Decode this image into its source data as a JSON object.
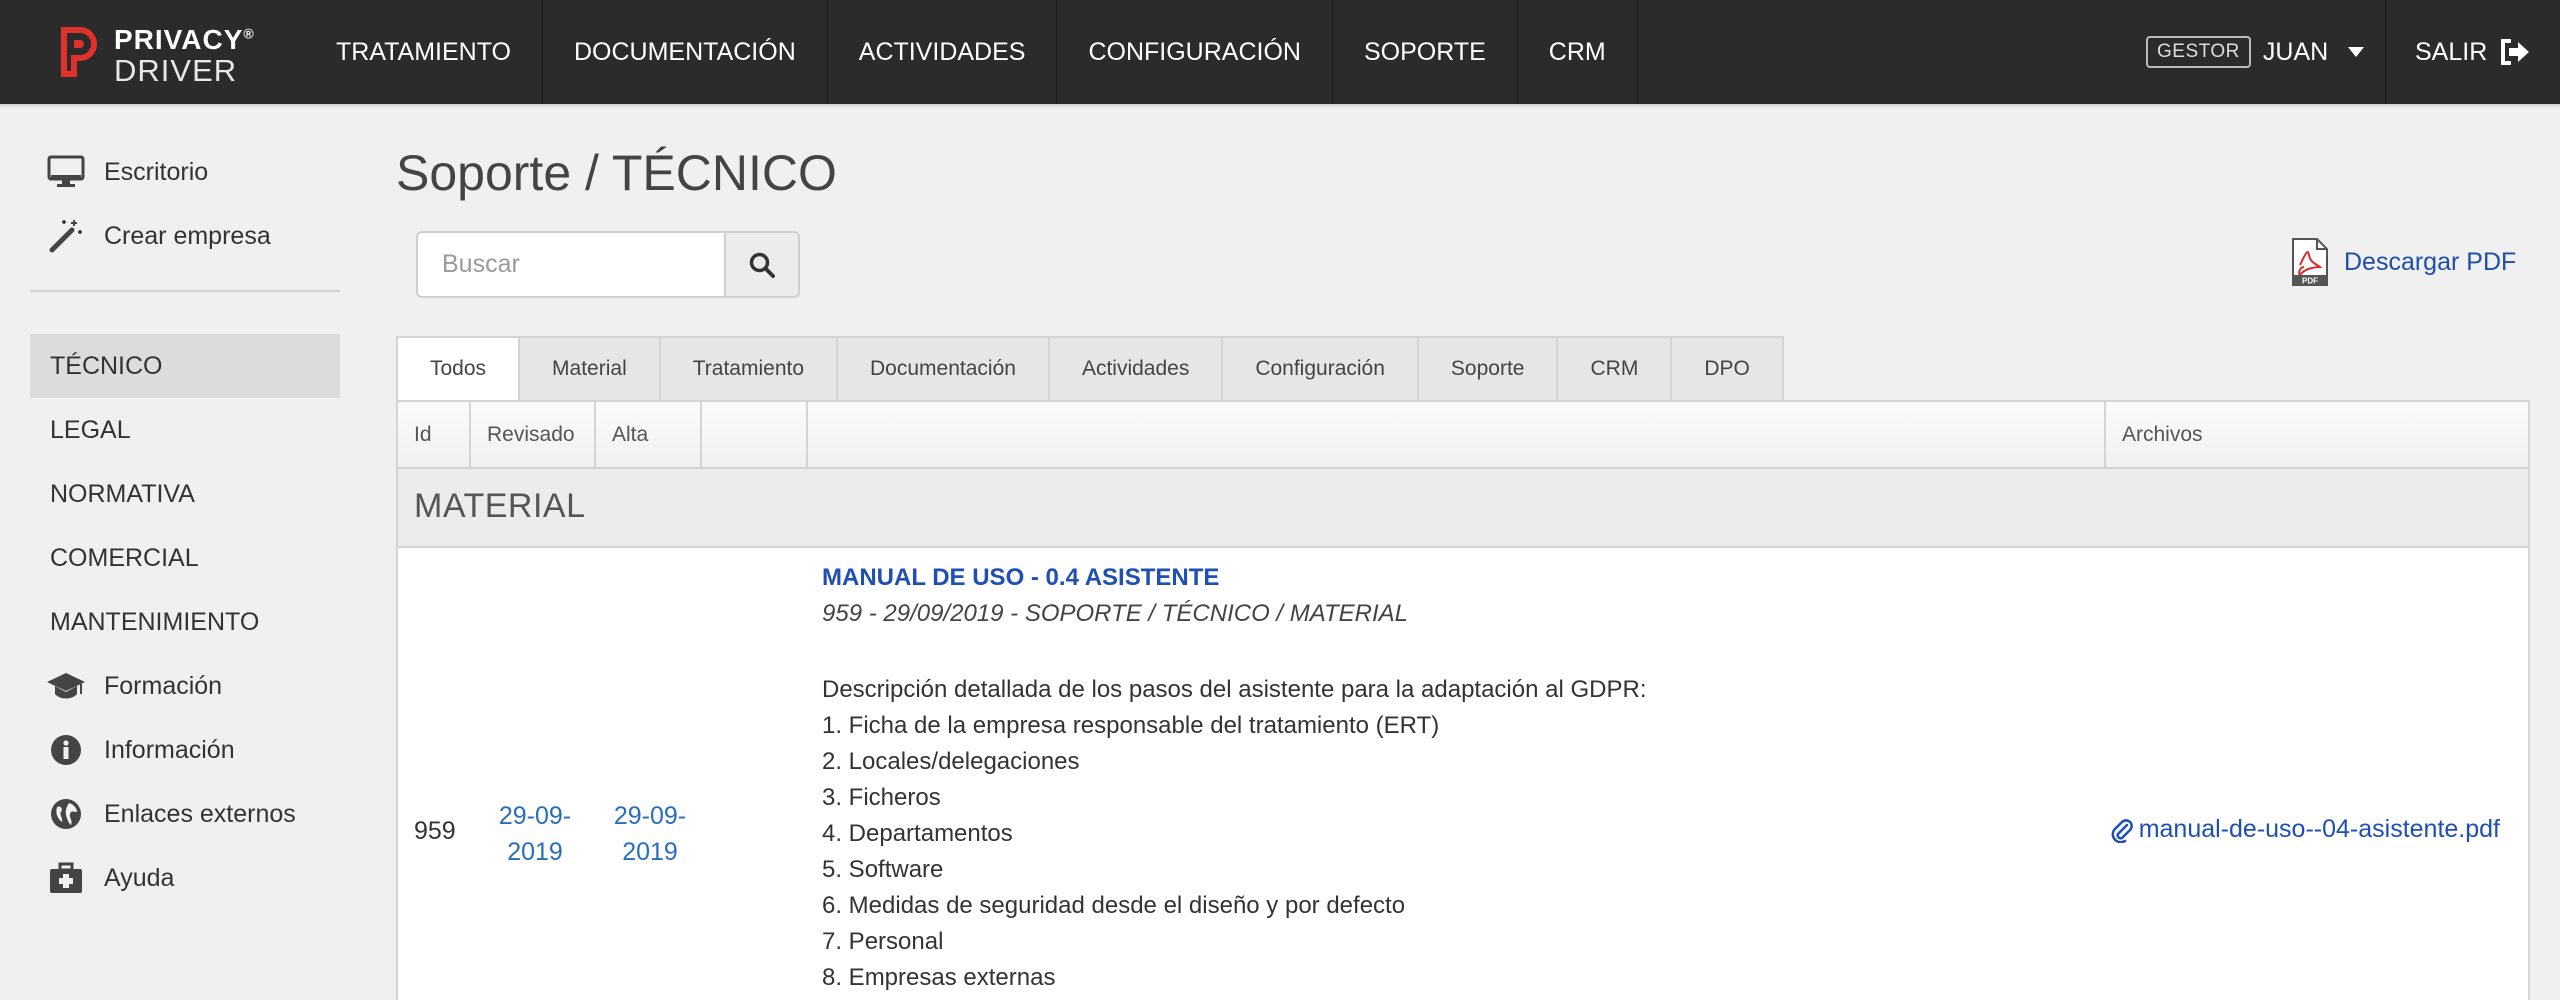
{
  "brand": {
    "line1": "PRIVACY",
    "line2": "DRIVER",
    "registered": "®",
    "accent_color": "#e0312b"
  },
  "topnav": {
    "items": [
      "TRATAMIENTO",
      "DOCUMENTACIÓN",
      "ACTIVIDADES",
      "CONFIGURACIÓN",
      "SOPORTE",
      "CRM"
    ],
    "role_badge": "GESTOR",
    "user": "JUAN",
    "logout": "SALIR"
  },
  "sidebar": {
    "top_items": [
      {
        "label": "Escritorio",
        "icon": "desktop-icon"
      },
      {
        "label": "Crear empresa",
        "icon": "magic-wand-icon"
      }
    ],
    "items": [
      {
        "label": "TÉCNICO",
        "active": true
      },
      {
        "label": "LEGAL"
      },
      {
        "label": "NORMATIVA"
      },
      {
        "label": "COMERCIAL"
      },
      {
        "label": "MANTENIMIENTO"
      }
    ],
    "bottom_items": [
      {
        "label": "Formación",
        "icon": "graduation-cap-icon"
      },
      {
        "label": "Información",
        "icon": "info-icon"
      },
      {
        "label": "Enlaces externos",
        "icon": "globe-icon"
      },
      {
        "label": "Ayuda",
        "icon": "medkit-icon"
      }
    ]
  },
  "main": {
    "title": "Soporte / TÉCNICO",
    "search": {
      "placeholder": "Buscar",
      "value": ""
    },
    "pdf_link": "Descargar PDF",
    "tabs": [
      "Todos",
      "Material",
      "Tratamiento",
      "Documentación",
      "Actividades",
      "Configuración",
      "Soporte",
      "CRM",
      "DPO"
    ],
    "active_tab": "Todos"
  },
  "table": {
    "columns": [
      "Id",
      "Revisado",
      "Alta",
      "",
      "",
      "Archivos"
    ],
    "section": "MATERIAL",
    "rows": [
      {
        "id": "959",
        "revisado": [
          "29-09-",
          "2019"
        ],
        "alta": [
          "29-09-",
          "2019"
        ],
        "title": "MANUAL DE USO - 0.4 ASISTENTE",
        "meta": "959 - 29/09/2019 - SOPORTE / TÉCNICO / MATERIAL",
        "description": [
          "Descripción detallada de los pasos del asistente para la adaptación al GDPR:",
          "1. Ficha de la empresa responsable del tratamiento (ERT)",
          "2. Locales/delegaciones",
          "3. Ficheros",
          "4. Departamentos",
          "5. Software",
          "6. Medidas de seguridad desde el diseño y por defecto",
          "7. Personal",
          "8. Empresas externas"
        ],
        "file": "manual-de-uso--04-asistente.pdf"
      }
    ]
  }
}
